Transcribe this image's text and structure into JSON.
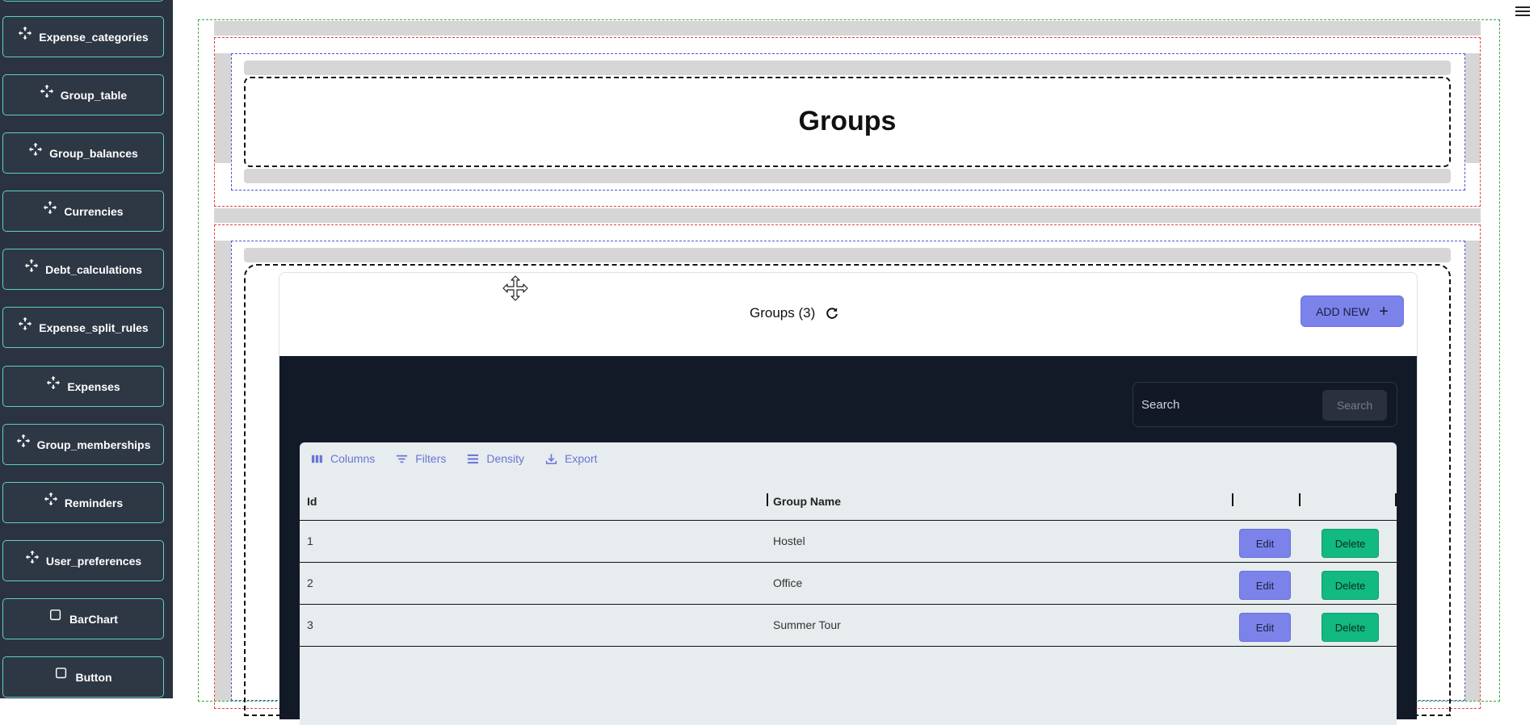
{
  "sidebar": {
    "items": [
      {
        "label": "Expense_categories",
        "icon": "move-icon"
      },
      {
        "label": "Group_table",
        "icon": "move-icon"
      },
      {
        "label": "Group_balances",
        "icon": "move-icon"
      },
      {
        "label": "Currencies",
        "icon": "move-icon"
      },
      {
        "label": "Debt_calculations",
        "icon": "move-icon"
      },
      {
        "label": "Expense_split_rules",
        "icon": "move-icon"
      },
      {
        "label": "Expenses",
        "icon": "move-icon"
      },
      {
        "label": "Group_memberships",
        "icon": "move-icon"
      },
      {
        "label": "Reminders",
        "icon": "move-icon"
      },
      {
        "label": "User_preferences",
        "icon": "move-icon"
      },
      {
        "label": "BarChart",
        "icon": "square-icon"
      },
      {
        "label": "Button",
        "icon": "square-icon"
      }
    ]
  },
  "page": {
    "title": "Groups"
  },
  "card": {
    "title": "Groups (3)",
    "add_new_label": "ADD NEW",
    "add_new_icon": "plus-icon"
  },
  "search": {
    "placeholder": "Search",
    "button_label": "Search"
  },
  "toolbar": {
    "columns_label": "Columns",
    "filters_label": "Filters",
    "density_label": "Density",
    "export_label": "Export"
  },
  "table": {
    "columns": [
      "Id",
      "Group Name"
    ],
    "rows": [
      {
        "id": "1",
        "name": "Hostel",
        "edit": "Edit",
        "delete": "Delete"
      },
      {
        "id": "2",
        "name": "Office",
        "edit": "Edit",
        "delete": "Delete"
      },
      {
        "id": "3",
        "name": "Summer Tour",
        "edit": "Edit",
        "delete": "Delete"
      }
    ]
  },
  "colors": {
    "sidebar_bg": "#2b3340",
    "sidebar_border": "#5fd0c3",
    "primary": "#7b83eb",
    "delete": "#12b981",
    "dark_panel": "#131a27",
    "grid_bg": "#e7ecee"
  }
}
